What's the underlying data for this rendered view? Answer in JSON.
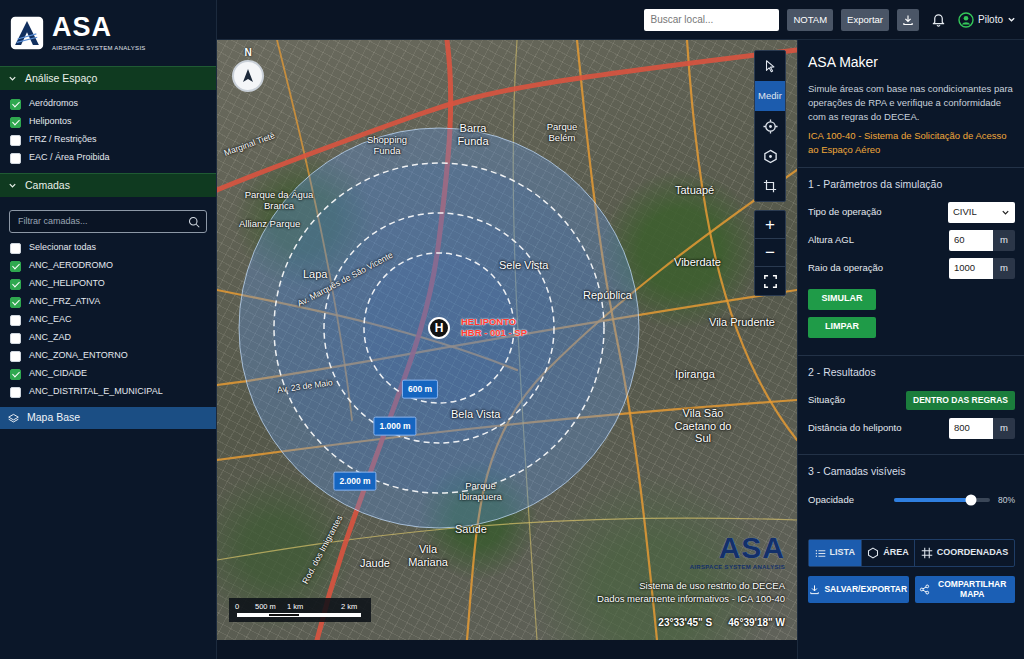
{
  "logo": {
    "name": "ASA",
    "tagline": "AIRSPACE SYSTEM ANALYSIS"
  },
  "sidebar": {
    "sections": [
      {
        "title": "Análise Espaço",
        "expanded": true,
        "items": [
          {
            "label": "Aeródromos",
            "checked": true
          },
          {
            "label": "Helipontos",
            "checked": true
          },
          {
            "label": "FRZ / Restrições",
            "checked": false
          },
          {
            "label": "EAC / Área Proibida",
            "checked": false
          }
        ]
      },
      {
        "title": "Camadas",
        "expanded": true,
        "filter": {
          "placeholder": "Filtrar camadas..."
        },
        "items": [
          {
            "label": "Selecionar todas",
            "checked": false
          },
          {
            "label": "ANC_AERODROMO",
            "checked": true
          },
          {
            "label": "ANC_HELIPONTO",
            "checked": true
          },
          {
            "label": "ANC_FRZ_ATIVA",
            "checked": true
          },
          {
            "label": "ANC_EAC",
            "checked": false
          },
          {
            "label": "ANC_ZAD",
            "checked": false
          },
          {
            "label": "ANC_ZONA_ENTORNO",
            "checked": false
          },
          {
            "label": "ANC_CIDADE",
            "checked": true
          },
          {
            "label": "ANC_DISTRITAL_E_MUNICIPAL",
            "checked": false
          }
        ]
      }
    ],
    "base_map": {
      "label": "Mapa Base",
      "selected": true
    }
  },
  "topbar": {
    "search": {
      "placeholder": "Buscar local..."
    },
    "buttons": [
      "NOTAM",
      "Exportar"
    ],
    "user": "Piloto"
  },
  "map": {
    "compass": "N",
    "labels": [
      {
        "kind": "road",
        "text": "Marginal Tietê"
      },
      {
        "kind": "landmark",
        "text": "Shopping Funda"
      },
      {
        "kind": "landmark",
        "text": "Parque da Água Branca"
      },
      {
        "kind": "landmark",
        "text": "Allianz Parque"
      },
      {
        "kind": "district",
        "text": "Barra Funda"
      },
      {
        "kind": "landmark",
        "text": "Parque Belém"
      },
      {
        "kind": "district",
        "text": "Tatuapé"
      },
      {
        "kind": "district",
        "text": "Lapa"
      },
      {
        "kind": "district",
        "text": "Sele Vista"
      },
      {
        "kind": "district",
        "text": "República"
      },
      {
        "kind": "district",
        "text": "Viberdate"
      },
      {
        "kind": "district",
        "text": "Vila Prudente"
      },
      {
        "kind": "road",
        "text": "Av. Marquês de São Vicente"
      },
      {
        "kind": "road",
        "text": "Av. 23 de Maio"
      },
      {
        "kind": "district",
        "text": "Ipiranga"
      },
      {
        "kind": "district",
        "text": "Bela Vista"
      },
      {
        "kind": "district",
        "text": "Vila São Caetano do Sul"
      },
      {
        "kind": "landmark",
        "text": "Parque Ibirapuera"
      },
      {
        "kind": "district",
        "text": "Saúde"
      },
      {
        "kind": "district",
        "text": "Vila Mariana"
      },
      {
        "kind": "district",
        "text": "Jaude"
      },
      {
        "kind": "road",
        "text": "Rod. dos Imigrantes"
      }
    ],
    "heliport": {
      "symbol": "H",
      "name": "HELIPONTO",
      "code": "HBR - 001 - SP"
    },
    "rings": [
      {
        "label": "600 m"
      },
      {
        "label": "1.000 m"
      },
      {
        "label": "2.000 m"
      }
    ],
    "tools": [
      {
        "kind": "pointer",
        "selected": false
      },
      {
        "kind": "measure",
        "label": "Medir",
        "selected": true
      },
      {
        "kind": "locate",
        "selected": false
      },
      {
        "kind": "polygon",
        "selected": false
      },
      {
        "kind": "rectangle",
        "selected": false
      }
    ],
    "zoom": [
      "+",
      "−"
    ],
    "watermark": {
      "name": "ASA",
      "tagline": "AIRSPACE SYSTEM ANALYSIS",
      "lines": [
        "Sistema de uso restrito do DECEA",
        "Dados meramente informativos - ICA 100-40"
      ]
    },
    "coordinates": {
      "lat": "23°33'45\" S",
      "lon": "46°39'18\" W"
    },
    "scale": [
      "0",
      "500 m",
      "1 km",
      "2 km"
    ]
  },
  "panel": {
    "title": "ASA Maker",
    "description": "Simule áreas com base nas condicionantes para operações de RPA e verifique a conformidade com as regras do DECEA.",
    "reference": "ICA 100-40 - Sistema de Solicitação de Acesso ao Espaço Aéreo",
    "params": {
      "title": "1 - Parâmetros da simulação",
      "fields": [
        {
          "kind": "select",
          "label": "Tipo de operação",
          "value": "CIVIL"
        },
        {
          "kind": "number",
          "label": "Altura AGL",
          "value": "60",
          "unit": "m"
        },
        {
          "kind": "number",
          "label": "Raio da operação",
          "value": "1000",
          "unit": "m"
        }
      ],
      "buttons": [
        "SIMULAR",
        "LIMPAR"
      ]
    },
    "results": {
      "title": "2 - Resultados",
      "status_label": "Situação",
      "status": "DENTRO DAS REGRAS",
      "distance": {
        "label": "Distância do heliponto",
        "value": "800",
        "unit": "m"
      }
    },
    "layers": {
      "title": "3 - Camadas visíveis",
      "opacity": {
        "label": "Opacidade",
        "level": 0.8,
        "reading": "80%"
      }
    },
    "tabs": [
      {
        "label": "LISTA",
        "selected": true
      },
      {
        "label": "ÁREA",
        "selected": false
      },
      {
        "label": "COORDENADAS",
        "selected": false
      }
    ],
    "actions": [
      "SALVAR/EXPORTAR",
      "COMPARTILHAR MAPA"
    ]
  }
}
